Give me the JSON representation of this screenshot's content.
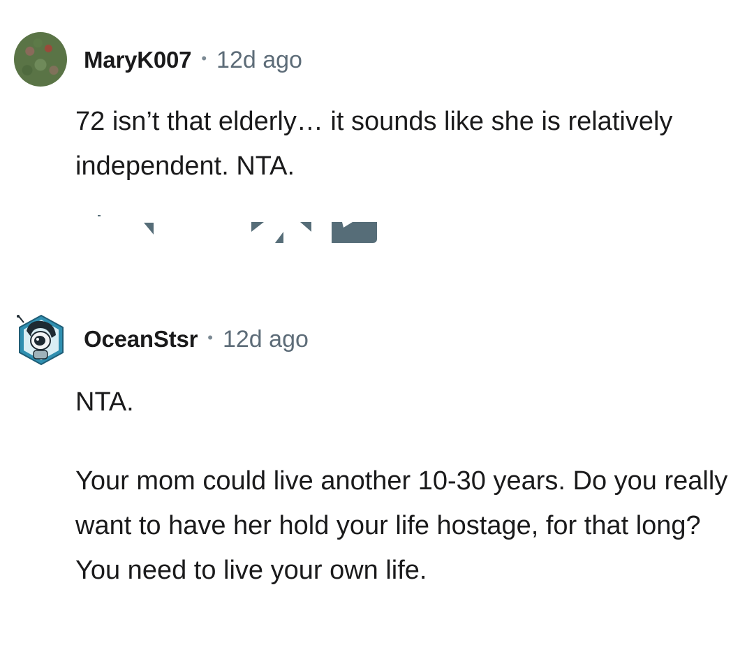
{
  "comments": [
    {
      "username": "MaryK007",
      "separator": "•",
      "timestamp": "12d ago",
      "paragraphs": [
        "72 isn’t that elderly… it sounds like she is relatively independent. NTA."
      ],
      "avatar_icon": "foliage-photo-avatar"
    },
    {
      "username": "OceanStsr",
      "separator": "•",
      "timestamp": "12d ago",
      "paragraphs": [
        "NTA.",
        "Your mom could live another 10-30 years. Do you really want to have her hold your life hostage, for that long? You need to live your own life."
      ],
      "avatar_icon": "robot-hex-avatar"
    }
  ],
  "colors": {
    "text": "#1a1a1b",
    "meta": "#5d6c78",
    "background": "#ffffff",
    "artifact": "#566d78"
  }
}
